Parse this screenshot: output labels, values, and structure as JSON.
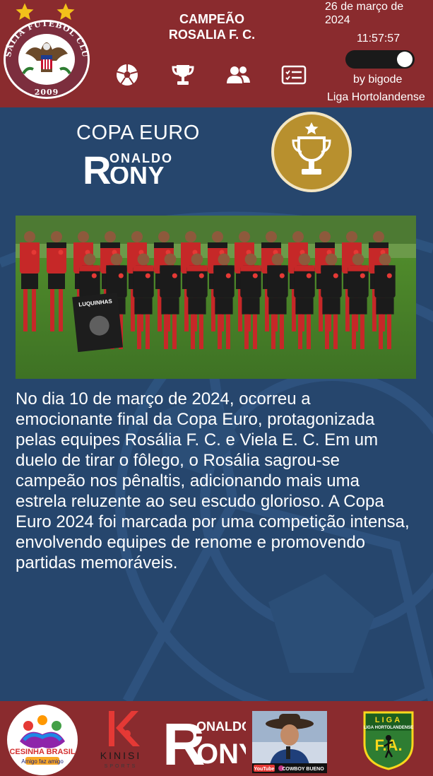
{
  "header": {
    "title_line1": "CAMPEÃO",
    "title_line2": "ROSALIA F. C.",
    "date": "26 de março de 2024",
    "time": "11:57:57",
    "byline": "by bigode",
    "league": "Liga Hortolandense",
    "crest": {
      "name": "ROSÁLIA FUTEBOL CLUBE",
      "year": "2009"
    },
    "nav": [
      {
        "icon": "soccer-ball-icon"
      },
      {
        "icon": "trophy-icon"
      },
      {
        "icon": "users-icon"
      },
      {
        "icon": "list-card-icon"
      }
    ],
    "star_color": "#f2c21a",
    "toggle_on": true
  },
  "main": {
    "competition_title": "COPA EURO",
    "sponsor_logo_text": "RONALDO RONY",
    "photo_alt": "Foto do time Rosália F. C.",
    "banner_text": "LUQUINHAS",
    "article": "No dia 10 de março de 2024, ocorreu a emocionante final da Copa Euro, protagonizada pelas equipes Rosália F. C. e Viela E. C. Em um duelo de tirar o fôlego, o Rosália sagrou-se campeão nos pênaltis, adicionando mais uma estrela reluzente ao seu escudo glorioso. A Copa Euro 2024 foi marcada por uma competição intensa, envolvendo equipes de renome e promovendo partidas memoráveis."
  },
  "footer": {
    "sponsors": [
      {
        "name": "CESINHA BRASIL",
        "tagline": "Amigo faz amigo"
      },
      {
        "name": "KINISI",
        "tagline": "SPORTS"
      },
      {
        "name": "RONALDO RONY"
      },
      {
        "name": "COWBOY BUENO",
        "channel": "YouTube"
      },
      {
        "name": "LIGA HORTOLANDENSE",
        "abbr": "F.A."
      }
    ]
  },
  "colors": {
    "header_bg": "#8a2b2e",
    "page_bg": "#26466d",
    "gold": "#b8902e"
  }
}
